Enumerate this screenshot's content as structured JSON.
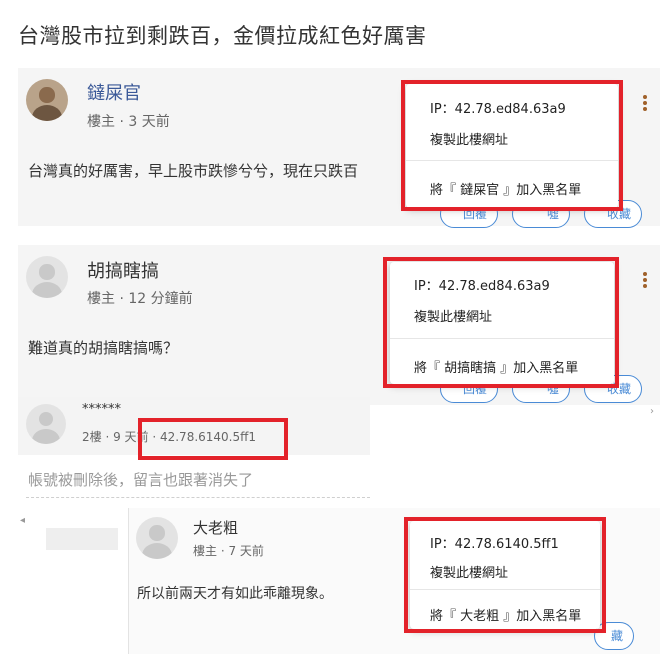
{
  "title": "台灣股市拉到剩跌百，金價拉成紅色好厲害",
  "posts": [
    {
      "author": "鐽屎官",
      "meta": "樓主 · 3 天前",
      "content": "台灣真的好厲害，早上股市跌慘兮兮，現在只跌百",
      "popup": {
        "ip": "IP：42.78.ed84.63a9",
        "copy": "複製此樓網址",
        "block": "將『 鐽屎官 』加入黑名單"
      },
      "pills": [
        "回覆",
        "噓",
        "收藏"
      ]
    },
    {
      "author": "胡搞瞎搞",
      "meta": "樓主 · 12 分鐘前",
      "content": "難道真的胡搞瞎搞嗎？",
      "popup": {
        "ip": "IP：42.78.ed84.63a9",
        "copy": "複製此樓網址",
        "block": "將『 胡搞瞎搞 』加入黑名單"
      },
      "pills": [
        "回覆",
        "噓",
        "收藏"
      ]
    }
  ],
  "reply": {
    "author": "******",
    "meta": "2樓 · 9 天前 · 42.78.6140.5ff1",
    "deleted_note": "帳號被刪除後，留言也跟著消失了"
  },
  "nested": {
    "author": "大老粗",
    "meta": "樓主 · 7 天前",
    "content": "所以前兩天才有如此乖離現象。",
    "popup": {
      "ip": "IP：42.78.6140.5ff1",
      "copy": "複製此樓網址",
      "block": "將『 大老粗 』加入黑名單"
    },
    "pill": "藏"
  },
  "colors": {
    "highlight_box": "#e3222a",
    "link_blue": "#4a8bd6",
    "menu_dots": "#a0612a"
  }
}
